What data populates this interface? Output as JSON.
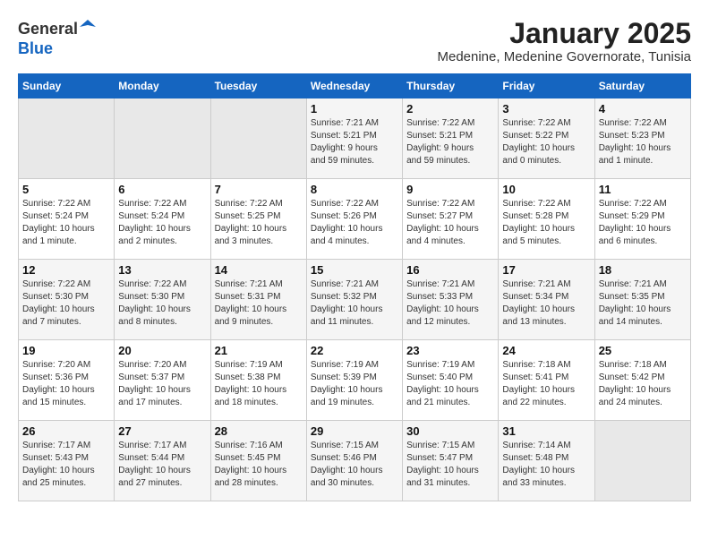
{
  "header": {
    "logo_line1": "General",
    "logo_line2": "Blue",
    "month_year": "January 2025",
    "location": "Medenine, Medenine Governorate, Tunisia"
  },
  "calendar": {
    "days_of_week": [
      "Sunday",
      "Monday",
      "Tuesday",
      "Wednesday",
      "Thursday",
      "Friday",
      "Saturday"
    ],
    "weeks": [
      [
        {
          "day": "",
          "info": ""
        },
        {
          "day": "",
          "info": ""
        },
        {
          "day": "",
          "info": ""
        },
        {
          "day": "1",
          "info": "Sunrise: 7:21 AM\nSunset: 5:21 PM\nDaylight: 9 hours\nand 59 minutes."
        },
        {
          "day": "2",
          "info": "Sunrise: 7:22 AM\nSunset: 5:21 PM\nDaylight: 9 hours\nand 59 minutes."
        },
        {
          "day": "3",
          "info": "Sunrise: 7:22 AM\nSunset: 5:22 PM\nDaylight: 10 hours\nand 0 minutes."
        },
        {
          "day": "4",
          "info": "Sunrise: 7:22 AM\nSunset: 5:23 PM\nDaylight: 10 hours\nand 1 minute."
        }
      ],
      [
        {
          "day": "5",
          "info": "Sunrise: 7:22 AM\nSunset: 5:24 PM\nDaylight: 10 hours\nand 1 minute."
        },
        {
          "day": "6",
          "info": "Sunrise: 7:22 AM\nSunset: 5:24 PM\nDaylight: 10 hours\nand 2 minutes."
        },
        {
          "day": "7",
          "info": "Sunrise: 7:22 AM\nSunset: 5:25 PM\nDaylight: 10 hours\nand 3 minutes."
        },
        {
          "day": "8",
          "info": "Sunrise: 7:22 AM\nSunset: 5:26 PM\nDaylight: 10 hours\nand 4 minutes."
        },
        {
          "day": "9",
          "info": "Sunrise: 7:22 AM\nSunset: 5:27 PM\nDaylight: 10 hours\nand 4 minutes."
        },
        {
          "day": "10",
          "info": "Sunrise: 7:22 AM\nSunset: 5:28 PM\nDaylight: 10 hours\nand 5 minutes."
        },
        {
          "day": "11",
          "info": "Sunrise: 7:22 AM\nSunset: 5:29 PM\nDaylight: 10 hours\nand 6 minutes."
        }
      ],
      [
        {
          "day": "12",
          "info": "Sunrise: 7:22 AM\nSunset: 5:30 PM\nDaylight: 10 hours\nand 7 minutes."
        },
        {
          "day": "13",
          "info": "Sunrise: 7:22 AM\nSunset: 5:30 PM\nDaylight: 10 hours\nand 8 minutes."
        },
        {
          "day": "14",
          "info": "Sunrise: 7:21 AM\nSunset: 5:31 PM\nDaylight: 10 hours\nand 9 minutes."
        },
        {
          "day": "15",
          "info": "Sunrise: 7:21 AM\nSunset: 5:32 PM\nDaylight: 10 hours\nand 11 minutes."
        },
        {
          "day": "16",
          "info": "Sunrise: 7:21 AM\nSunset: 5:33 PM\nDaylight: 10 hours\nand 12 minutes."
        },
        {
          "day": "17",
          "info": "Sunrise: 7:21 AM\nSunset: 5:34 PM\nDaylight: 10 hours\nand 13 minutes."
        },
        {
          "day": "18",
          "info": "Sunrise: 7:21 AM\nSunset: 5:35 PM\nDaylight: 10 hours\nand 14 minutes."
        }
      ],
      [
        {
          "day": "19",
          "info": "Sunrise: 7:20 AM\nSunset: 5:36 PM\nDaylight: 10 hours\nand 15 minutes."
        },
        {
          "day": "20",
          "info": "Sunrise: 7:20 AM\nSunset: 5:37 PM\nDaylight: 10 hours\nand 17 minutes."
        },
        {
          "day": "21",
          "info": "Sunrise: 7:19 AM\nSunset: 5:38 PM\nDaylight: 10 hours\nand 18 minutes."
        },
        {
          "day": "22",
          "info": "Sunrise: 7:19 AM\nSunset: 5:39 PM\nDaylight: 10 hours\nand 19 minutes."
        },
        {
          "day": "23",
          "info": "Sunrise: 7:19 AM\nSunset: 5:40 PM\nDaylight: 10 hours\nand 21 minutes."
        },
        {
          "day": "24",
          "info": "Sunrise: 7:18 AM\nSunset: 5:41 PM\nDaylight: 10 hours\nand 22 minutes."
        },
        {
          "day": "25",
          "info": "Sunrise: 7:18 AM\nSunset: 5:42 PM\nDaylight: 10 hours\nand 24 minutes."
        }
      ],
      [
        {
          "day": "26",
          "info": "Sunrise: 7:17 AM\nSunset: 5:43 PM\nDaylight: 10 hours\nand 25 minutes."
        },
        {
          "day": "27",
          "info": "Sunrise: 7:17 AM\nSunset: 5:44 PM\nDaylight: 10 hours\nand 27 minutes."
        },
        {
          "day": "28",
          "info": "Sunrise: 7:16 AM\nSunset: 5:45 PM\nDaylight: 10 hours\nand 28 minutes."
        },
        {
          "day": "29",
          "info": "Sunrise: 7:15 AM\nSunset: 5:46 PM\nDaylight: 10 hours\nand 30 minutes."
        },
        {
          "day": "30",
          "info": "Sunrise: 7:15 AM\nSunset: 5:47 PM\nDaylight: 10 hours\nand 31 minutes."
        },
        {
          "day": "31",
          "info": "Sunrise: 7:14 AM\nSunset: 5:48 PM\nDaylight: 10 hours\nand 33 minutes."
        },
        {
          "day": "",
          "info": ""
        }
      ]
    ]
  }
}
